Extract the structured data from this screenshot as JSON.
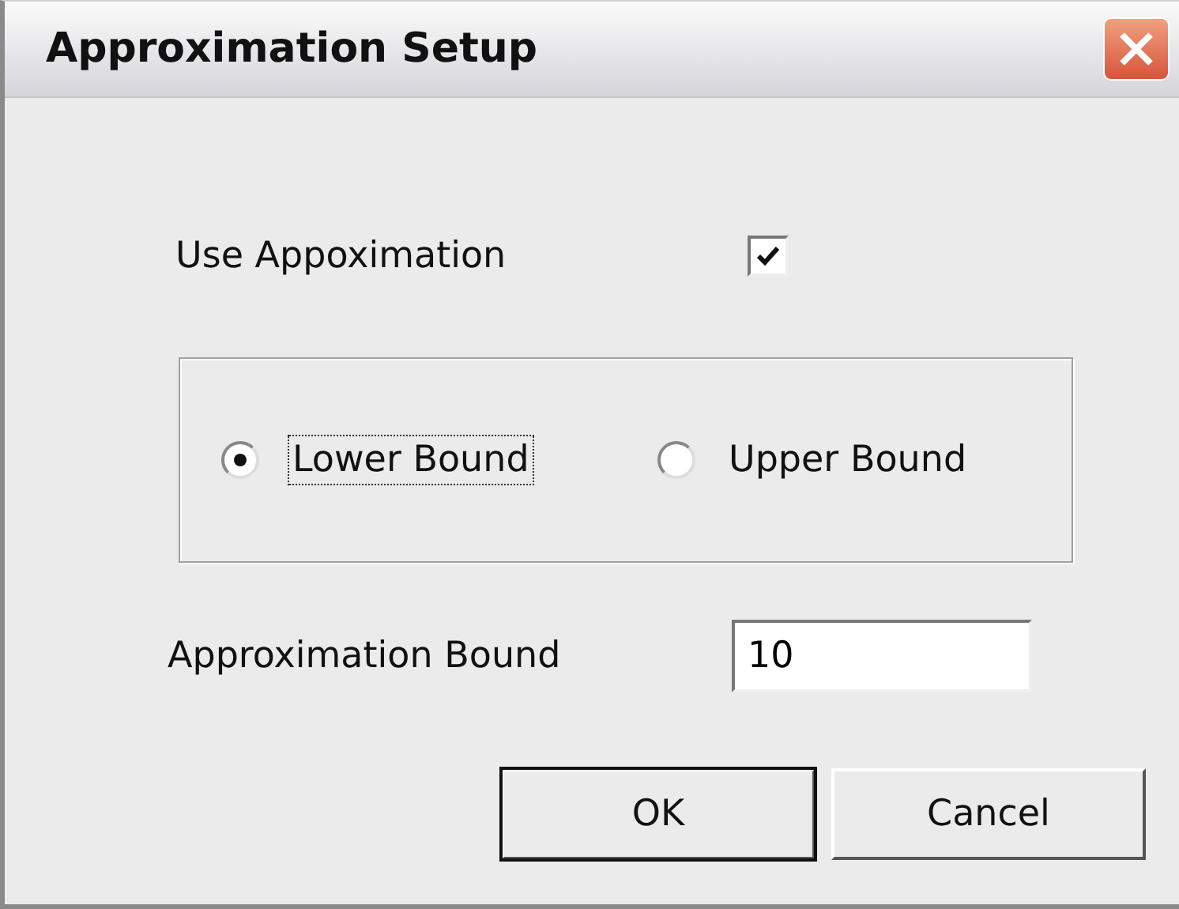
{
  "window": {
    "title": "Approximation Setup"
  },
  "use_approximation": {
    "label": "Use Appoximation",
    "checked": true
  },
  "bound_options": [
    {
      "label": "Lower Bound",
      "selected": true
    },
    {
      "label": "Upper Bound",
      "selected": false
    }
  ],
  "approximation_bound": {
    "label": "Approximation Bound",
    "value": "10"
  },
  "buttons": [
    {
      "label": "OK",
      "default": true
    },
    {
      "label": "Cancel",
      "default": false
    }
  ]
}
